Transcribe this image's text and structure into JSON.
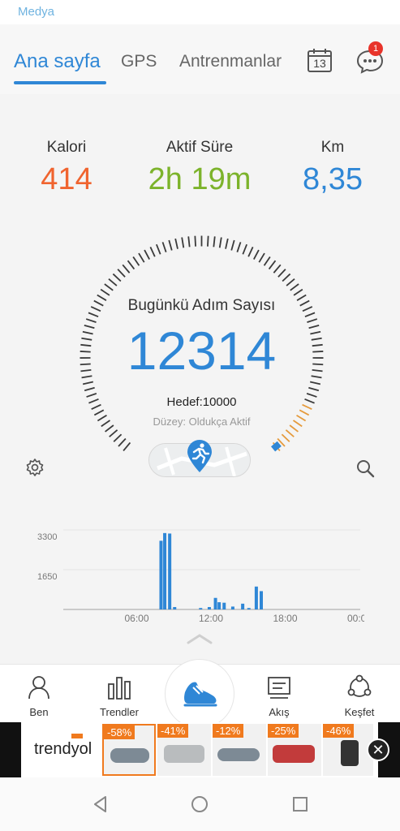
{
  "status_bar": {
    "app_label": "Medya"
  },
  "tabs": [
    {
      "label": "Ana sayfa"
    },
    {
      "label": "GPS"
    },
    {
      "label": "Antrenmanlar"
    }
  ],
  "calendar": {
    "day": "13"
  },
  "notifications": {
    "badge": "1"
  },
  "stats": [
    {
      "label": "Kalori",
      "value": "414",
      "color": "#f0642f"
    },
    {
      "label": "Aktif Süre",
      "value": "2h 19m",
      "color": "#7cb32b"
    },
    {
      "label": "Km",
      "value": "8,35",
      "color": "#2f87d6"
    }
  ],
  "gauge": {
    "title": "Bugünkü Adım Sayısı",
    "steps": "12314",
    "goal": "Hedef:10000",
    "level": "Düzey: Oldukça Aktif",
    "progress_fraction": 1.0
  },
  "chart_data": {
    "type": "bar",
    "ylim": [
      0,
      3300
    ],
    "yticks": [
      "3300",
      "1650"
    ],
    "xticks": [
      "06:00",
      "12:00",
      "18:00",
      "00:00"
    ],
    "x_hours": [
      7.9,
      8.2,
      8.6,
      9.0,
      11.1,
      11.8,
      12.3,
      12.6,
      13.0,
      13.7,
      14.5,
      15.0,
      15.6,
      16.0
    ],
    "values": [
      2850,
      3170,
      3150,
      100,
      60,
      100,
      480,
      300,
      280,
      120,
      240,
      60,
      950,
      760
    ],
    "color": "#2f87d6"
  },
  "bottom_nav": [
    {
      "label": "Ben",
      "icon": "person-icon"
    },
    {
      "label": "Trendler",
      "icon": "bar-chart-icon"
    },
    {
      "label": "Akış",
      "icon": "feed-icon"
    },
    {
      "label": "Keşfet",
      "icon": "discover-icon"
    }
  ],
  "ad": {
    "brand": "trendyol",
    "discounts": [
      "-58%",
      "-41%",
      "-12%",
      "-25%",
      "-46%"
    ]
  }
}
